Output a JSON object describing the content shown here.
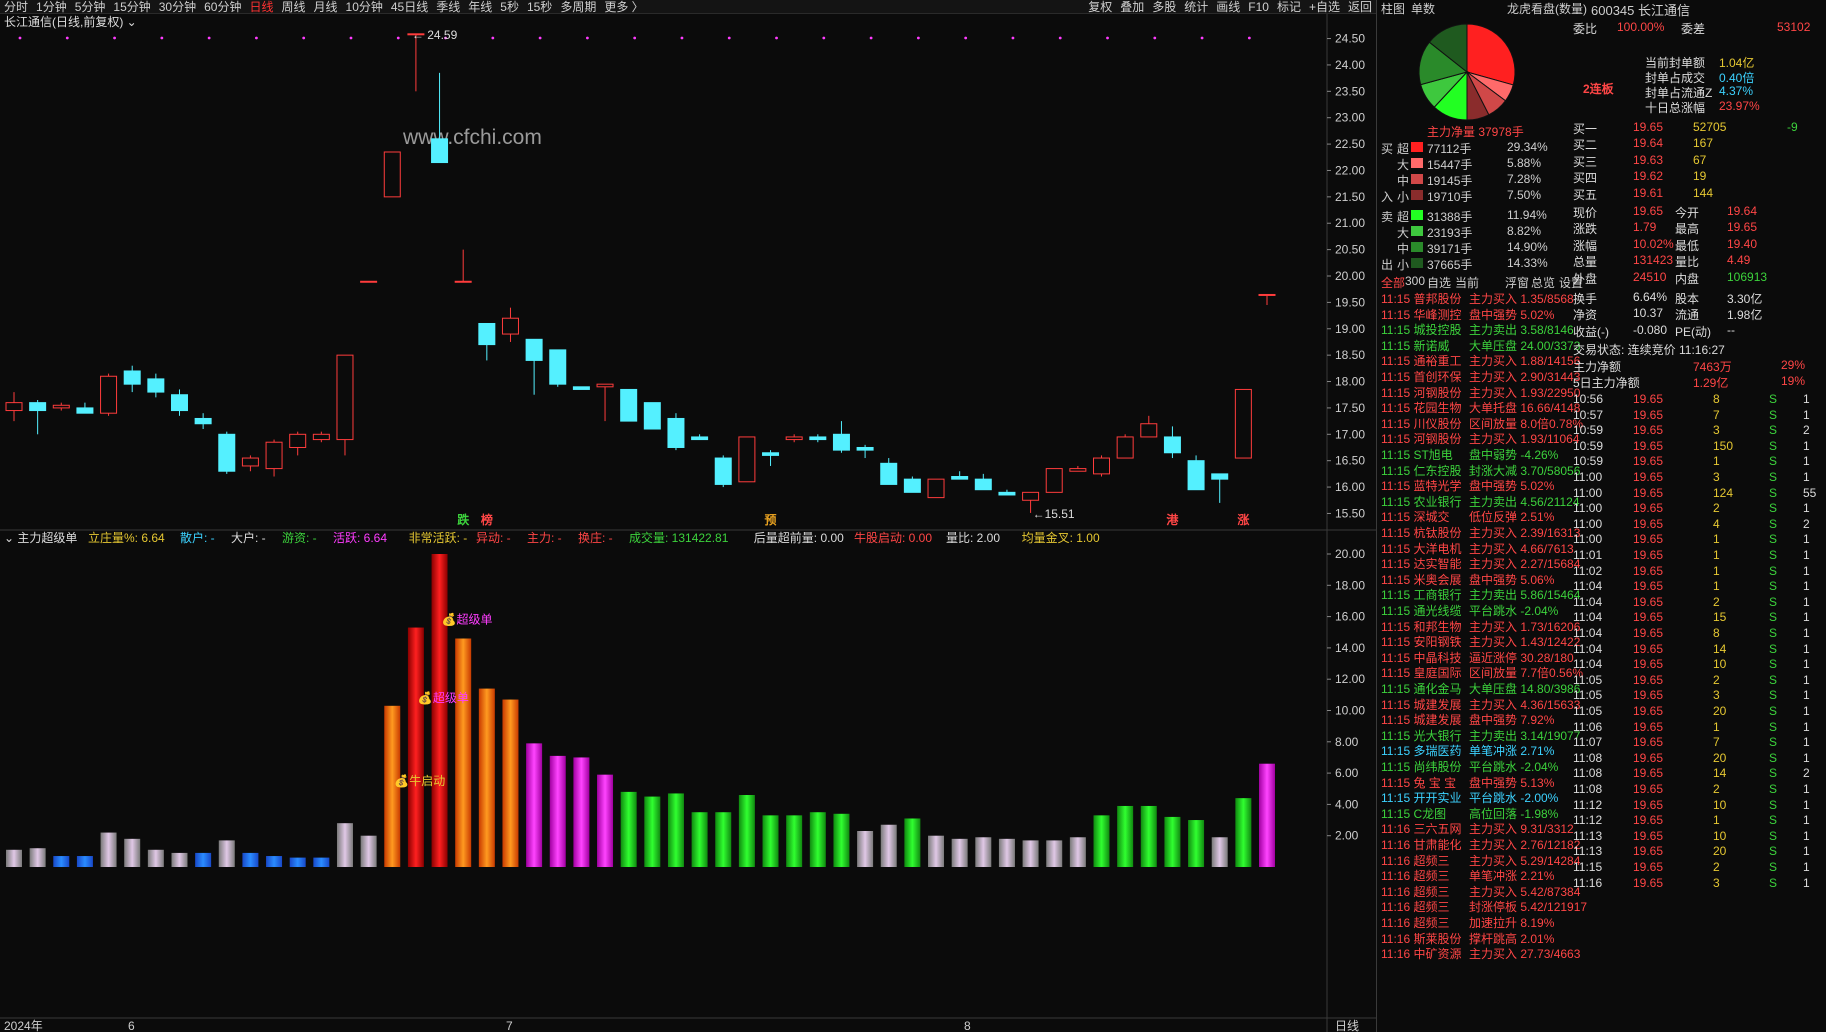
{
  "toolbar": {
    "periods": [
      "分时",
      "1分钟",
      "5分钟",
      "15分钟",
      "30分钟",
      "60分钟",
      "日线",
      "周线",
      "月线",
      "10分钟",
      "45日线",
      "季线",
      "年线",
      "5秒",
      "15秒",
      "多周期",
      "更多 〉"
    ],
    "active": "日线",
    "right": [
      "复权",
      "叠加",
      "多股",
      "统计",
      "画线",
      "F10",
      "标记",
      "+自选",
      "返回"
    ]
  },
  "main_chart": {
    "title": "长江通信(日线,前复权)",
    "watermark": "www.cfchi.com",
    "high_label": "24.59",
    "low_label": "15.51",
    "y_ticks": [
      "24.50",
      "24.00",
      "23.50",
      "23.00",
      "22.50",
      "22.00",
      "21.50",
      "21.00",
      "20.50",
      "20.00",
      "19.50",
      "19.00",
      "18.50",
      "18.00",
      "17.50",
      "17.00",
      "16.50",
      "16.00",
      "15.50"
    ],
    "markers": [
      "跌",
      "榜",
      "预",
      "港",
      "涨"
    ]
  },
  "indicator": {
    "name": "主力超级单",
    "fields": [
      [
        "立庄量%: 6.64",
        "y"
      ],
      [
        "散户: -",
        "c"
      ],
      [
        "大户: -",
        "w"
      ],
      [
        "游资: -",
        "g"
      ],
      [
        "活跃: 6.64",
        "m"
      ],
      [
        "非常活跃: -",
        "y"
      ],
      [
        "异动: -",
        "r"
      ],
      [
        "主力: -",
        "r"
      ],
      [
        "换庄: -",
        "r"
      ],
      [
        "成交量: 131422.81",
        "g"
      ],
      [
        "后量超前量: 0.00",
        "w"
      ],
      [
        "牛股启动: 0.00",
        "r"
      ],
      [
        "量比: 2.00",
        "w"
      ],
      [
        "均量金叉: 1.00",
        "y"
      ]
    ],
    "y_ticks": [
      "20.00",
      "18.00",
      "16.00",
      "14.00",
      "12.00",
      "10.00",
      "8.00",
      "6.00",
      "4.00",
      "2.00"
    ],
    "labels": [
      "超级单",
      "超级单",
      "牛启动"
    ]
  },
  "x_axis": {
    "labels": [
      "2024年",
      "6",
      "7",
      "8"
    ],
    "corner": "日线"
  },
  "chart_data": {
    "type": "candlestick",
    "candles": [
      [
        17.45,
        17.6,
        17.25,
        17.8
      ],
      [
        17.6,
        17.45,
        17.0,
        17.65
      ],
      [
        17.5,
        17.55,
        17.45,
        17.6
      ],
      [
        17.5,
        17.4,
        17.4,
        17.6
      ],
      [
        17.4,
        18.1,
        17.35,
        18.15
      ],
      [
        18.2,
        17.95,
        17.8,
        18.3
      ],
      [
        18.05,
        17.8,
        17.7,
        18.15
      ],
      [
        17.75,
        17.45,
        17.35,
        17.85
      ],
      [
        17.3,
        17.2,
        17.1,
        17.4
      ],
      [
        17.0,
        16.3,
        16.25,
        17.05
      ],
      [
        16.4,
        16.55,
        16.3,
        16.6
      ],
      [
        16.35,
        16.85,
        16.2,
        16.9
      ],
      [
        16.75,
        17.0,
        16.6,
        17.05
      ],
      [
        16.9,
        17.0,
        16.85,
        17.05
      ],
      [
        16.9,
        18.5,
        16.6,
        18.5
      ],
      [
        19.9,
        19.9,
        19.9,
        19.9
      ],
      [
        21.5,
        22.35,
        21.5,
        22.35
      ],
      [
        24.59,
        24.59,
        23.5,
        24.59
      ],
      [
        22.6,
        22.15,
        22.15,
        23.85
      ],
      [
        19.9,
        19.9,
        19.9,
        20.5
      ],
      [
        19.1,
        18.7,
        18.4,
        19.1
      ],
      [
        18.9,
        19.2,
        18.75,
        19.4
      ],
      [
        18.8,
        18.4,
        17.75,
        18.8
      ],
      [
        18.6,
        17.95,
        17.9,
        18.6
      ],
      [
        17.9,
        17.85,
        17.85,
        17.9
      ],
      [
        17.9,
        17.95,
        17.25,
        17.95
      ],
      [
        17.85,
        17.25,
        17.25,
        17.85
      ],
      [
        17.6,
        17.1,
        17.1,
        17.6
      ],
      [
        17.3,
        16.75,
        16.7,
        17.4
      ],
      [
        16.95,
        16.9,
        16.9,
        17.0
      ],
      [
        16.55,
        16.05,
        16.0,
        16.6
      ],
      [
        16.1,
        16.95,
        16.1,
        16.95
      ],
      [
        16.65,
        16.6,
        16.4,
        16.7
      ],
      [
        16.9,
        16.95,
        16.85,
        17.0
      ],
      [
        16.95,
        16.9,
        16.85,
        17.0
      ],
      [
        17.0,
        16.7,
        16.65,
        17.25
      ],
      [
        16.75,
        16.7,
        16.55,
        16.8
      ],
      [
        16.45,
        16.05,
        16.05,
        16.55
      ],
      [
        16.15,
        15.9,
        15.9,
        16.2
      ],
      [
        15.8,
        16.15,
        15.8,
        16.15
      ],
      [
        16.2,
        16.15,
        16.15,
        16.3
      ],
      [
        16.15,
        15.95,
        15.95,
        16.25
      ],
      [
        15.9,
        15.85,
        15.85,
        15.95
      ],
      [
        15.75,
        15.9,
        15.51,
        15.9
      ],
      [
        15.9,
        16.35,
        15.9,
        16.35
      ],
      [
        16.3,
        16.35,
        16.3,
        16.4
      ],
      [
        16.25,
        16.55,
        16.2,
        16.6
      ],
      [
        16.55,
        16.95,
        16.55,
        17.0
      ],
      [
        16.95,
        17.2,
        16.95,
        17.35
      ],
      [
        16.95,
        16.65,
        16.55,
        17.15
      ],
      [
        16.5,
        15.95,
        15.95,
        16.6
      ],
      [
        16.25,
        16.15,
        15.7,
        16.25
      ],
      [
        16.55,
        17.85,
        16.55,
        17.85
      ],
      [
        19.65,
        19.65,
        19.45,
        19.65
      ]
    ],
    "vol": [
      [
        1.1,
        "s"
      ],
      [
        1.2,
        "s"
      ],
      [
        0.7,
        "b"
      ],
      [
        0.7,
        "b"
      ],
      [
        2.2,
        "s"
      ],
      [
        1.8,
        "s"
      ],
      [
        1.1,
        "s"
      ],
      [
        0.9,
        "s"
      ],
      [
        0.9,
        "b"
      ],
      [
        1.7,
        "s"
      ],
      [
        0.9,
        "b"
      ],
      [
        0.7,
        "b"
      ],
      [
        0.6,
        "b"
      ],
      [
        0.6,
        "b"
      ],
      [
        2.8,
        "s"
      ],
      [
        2.0,
        "s"
      ],
      [
        10.3,
        "o"
      ],
      [
        15.3,
        "d"
      ],
      [
        20.0,
        "d"
      ],
      [
        14.6,
        "o"
      ],
      [
        11.4,
        "o"
      ],
      [
        10.7,
        "o"
      ],
      [
        7.9,
        "p"
      ],
      [
        7.1,
        "p"
      ],
      [
        7.0,
        "p"
      ],
      [
        5.9,
        "p"
      ],
      [
        4.8,
        "gr"
      ],
      [
        4.5,
        "gr"
      ],
      [
        4.7,
        "gr"
      ],
      [
        3.5,
        "gr"
      ],
      [
        3.5,
        "gr"
      ],
      [
        4.6,
        "gr"
      ],
      [
        3.3,
        "gr"
      ],
      [
        3.3,
        "gr"
      ],
      [
        3.5,
        "gr"
      ],
      [
        3.4,
        "gr"
      ],
      [
        2.3,
        "s"
      ],
      [
        2.7,
        "s"
      ],
      [
        3.1,
        "gr"
      ],
      [
        2.0,
        "s"
      ],
      [
        1.8,
        "s"
      ],
      [
        1.9,
        "s"
      ],
      [
        1.8,
        "s"
      ],
      [
        1.7,
        "s"
      ],
      [
        1.7,
        "s"
      ],
      [
        1.9,
        "s"
      ],
      [
        3.3,
        "gr"
      ],
      [
        3.9,
        "gr"
      ],
      [
        3.9,
        "gr"
      ],
      [
        3.2,
        "gr"
      ],
      [
        3.0,
        "gr"
      ],
      [
        1.9,
        "s"
      ],
      [
        4.4,
        "gr"
      ],
      [
        6.6,
        "p"
      ]
    ]
  },
  "right": {
    "head": {
      "tabs": [
        "柱图",
        "单数"
      ],
      "title": "龙虎看盘(数量)",
      "code": "600345 长江通信"
    },
    "pie": {
      "label": "主力净量 37978手",
      "slices": [
        [
          29.34,
          "#ff2020"
        ],
        [
          5.88,
          "#ff6a6a"
        ],
        [
          7.28,
          "#d04848"
        ],
        [
          7.5,
          "#8a2c2c"
        ],
        [
          11.94,
          "#22ff22"
        ],
        [
          8.82,
          "#3ec83e"
        ],
        [
          14.9,
          "#2a8a2a"
        ],
        [
          14.33,
          "#1f5a1f"
        ]
      ]
    },
    "flow": [
      [
        "买",
        "超",
        "77112手",
        "29.34%",
        "#ff2020"
      ],
      [
        "",
        "大",
        "15447手",
        "5.88%",
        "#ff6a6a"
      ],
      [
        "",
        "中",
        "19145手",
        "7.28%",
        "#d04848"
      ],
      [
        "入",
        "小",
        "19710手",
        "7.50%",
        "#8a2c2c"
      ],
      [
        "卖",
        "超",
        "31388手",
        "11.94%",
        "#22ff22"
      ],
      [
        "",
        "大",
        "23193手",
        "8.82%",
        "#3ec83e"
      ],
      [
        "",
        "中",
        "39171手",
        "14.90%",
        "#2a8a2a"
      ],
      [
        "出",
        "小",
        "37665手",
        "14.33%",
        "#1f5a1f"
      ]
    ],
    "filters": [
      "全部",
      "300",
      "自选",
      "当前",
      "浮窗",
      "总览",
      "设置"
    ],
    "alerts": [
      [
        "11:15",
        "普邦股份",
        "主力买入",
        "1.35/8568",
        "r"
      ],
      [
        "11:15",
        "华峰测控",
        "盘中强势",
        "5.02%",
        "r"
      ],
      [
        "11:15",
        "城投控股",
        "主力卖出",
        "3.58/8146",
        "g"
      ],
      [
        "11:15",
        "新诺威",
        "大单压盘",
        "24.00/3373",
        "g"
      ],
      [
        "11:15",
        "通裕重工",
        "主力买入",
        "1.88/14156",
        "r"
      ],
      [
        "11:15",
        "首创环保",
        "主力买入",
        "2.90/31443",
        "r"
      ],
      [
        "11:15",
        "河钢股份",
        "主力买入",
        "1.93/22950",
        "r"
      ],
      [
        "11:15",
        "花园生物",
        "大单托盘",
        "16.66/4148",
        "r"
      ],
      [
        "11:15",
        "川仪股份",
        "区间放量",
        "8.0倍0.78%",
        "r"
      ],
      [
        "11:15",
        "河钢股份",
        "主力买入",
        "1.93/11064",
        "r"
      ],
      [
        "11:15",
        "ST旭电",
        "盘中弱势",
        "-4.26%",
        "g"
      ],
      [
        "11:15",
        "仁东控股",
        "封涨大减",
        "3.70/58056",
        "g"
      ],
      [
        "11:15",
        "蓝特光学",
        "盘中强势",
        "5.02%",
        "r"
      ],
      [
        "11:15",
        "农业银行",
        "主力卖出",
        "4.56/21124",
        "g"
      ],
      [
        "11:15",
        "深城交",
        "低位反弹",
        "2.51%",
        "r"
      ],
      [
        "11:15",
        "杭钛股份",
        "主力买入",
        "2.39/16313",
        "r"
      ],
      [
        "11:15",
        "大洋电机",
        "主力买入",
        "4.66/7613",
        "r"
      ],
      [
        "11:15",
        "达实智能",
        "主力买入",
        "2.27/15684",
        "r"
      ],
      [
        "11:15",
        "米奥会展",
        "盘中强势",
        "5.06%",
        "r"
      ],
      [
        "11:15",
        "工商银行",
        "主力卖出",
        "5.86/15464",
        "g"
      ],
      [
        "11:15",
        "通光线缆",
        "平台跳水",
        "-2.04%",
        "g"
      ],
      [
        "11:15",
        "和邦生物",
        "主力买入",
        "1.73/16206",
        "r"
      ],
      [
        "11:15",
        "安阳钢铁",
        "主力买入",
        "1.43/12422",
        "r"
      ],
      [
        "11:15",
        "中晶科技",
        "逼近涨停",
        "30.28/180",
        "r"
      ],
      [
        "11:15",
        "皇庭国际",
        "区间放量",
        "7.7倍0.56%",
        "r"
      ],
      [
        "11:15",
        "通化金马",
        "大单压盘",
        "14.80/3986",
        "g"
      ],
      [
        "11:15",
        "城建发展",
        "主力买入",
        "4.36/15633",
        "r"
      ],
      [
        "11:15",
        "城建发展",
        "盘中强势",
        "7.92%",
        "r"
      ],
      [
        "11:15",
        "光大银行",
        "主力卖出",
        "3.14/19077",
        "g"
      ],
      [
        "11:15",
        "多瑞医药",
        "单笔冲涨",
        "2.71%",
        "c"
      ],
      [
        "11:15",
        "尚纬股份",
        "平台跳水",
        "-2.04%",
        "g"
      ],
      [
        "11:15",
        "兔 宝 宝",
        "盘中强势",
        "5.13%",
        "r"
      ],
      [
        "11:15",
        "开开实业",
        "平台跳水",
        "-2.00%",
        "c"
      ],
      [
        "11:15",
        "C龙图",
        "高位回落",
        "-1.98%",
        "g"
      ],
      [
        "11:16",
        "三六五网",
        "主力买入",
        "9.31/3312",
        "r"
      ],
      [
        "11:16",
        "甘肃能化",
        "主力买入",
        "2.76/12182",
        "r"
      ],
      [
        "11:16",
        "超频三",
        "主力买入",
        "5.29/14284",
        "r"
      ],
      [
        "11:16",
        "超频三",
        "单笔冲涨",
        "2.21%",
        "r"
      ],
      [
        "11:16",
        "超频三",
        "主力买入",
        "5.42/87384",
        "r"
      ],
      [
        "11:16",
        "超频三",
        "封涨停板",
        "5.42/121917",
        "r"
      ],
      [
        "11:16",
        "超频三",
        "加速拉升",
        "8.19%",
        "r"
      ],
      [
        "11:16",
        "斯莱股份",
        "撑杆跳高",
        "2.01%",
        "r"
      ],
      [
        "11:16",
        "中矿资源",
        "主力买入",
        "27.73/4663",
        "r"
      ]
    ],
    "q": {
      "ratio": [
        "委比",
        "100.00%",
        "委差",
        "53102"
      ],
      "seal": [
        [
          "当前封单额",
          "1.04亿",
          "y"
        ],
        [
          "封单占成交",
          "0.40倍",
          "c"
        ],
        [
          "封单占流通Z",
          "4.37%",
          "c"
        ],
        [
          "十日总涨幅",
          "23.97%",
          "r"
        ]
      ],
      "streak": "2连板",
      "bids": [
        [
          "买一",
          "19.65",
          "52705",
          "-9"
        ],
        [
          "买二",
          "19.64",
          "167",
          ""
        ],
        [
          "买三",
          "19.63",
          "67",
          ""
        ],
        [
          "买四",
          "19.62",
          "19",
          ""
        ],
        [
          "买五",
          "19.61",
          "144",
          ""
        ]
      ],
      "stats": [
        [
          "现价",
          "19.65",
          "今开",
          "19.64"
        ],
        [
          "涨跌",
          "1.79",
          "最高",
          "19.65"
        ],
        [
          "涨幅",
          "10.02%",
          "最低",
          "19.40"
        ],
        [
          "总量",
          "131423",
          "量比",
          "4.49"
        ],
        [
          "外盘",
          "24510",
          "内盘",
          "106913"
        ],
        [
          "换手",
          "6.64%",
          "股本",
          "3.30亿"
        ],
        [
          "净资",
          "10.37",
          "流通",
          "1.98亿"
        ],
        [
          "收益(-)",
          "-0.080",
          "PE(动)",
          "--"
        ]
      ],
      "state": "交易状态: 连续竞价 11:16:27",
      "net": [
        [
          "主力净额",
          "7463万",
          "29%"
        ],
        [
          "5日主力净额",
          "1.29亿",
          "19%"
        ]
      ],
      "ticks": [
        [
          "10:56",
          "19.65",
          "8",
          "S",
          "1"
        ],
        [
          "10:57",
          "19.65",
          "7",
          "S",
          "1"
        ],
        [
          "10:59",
          "19.65",
          "3",
          "S",
          "2"
        ],
        [
          "10:59",
          "19.65",
          "150",
          "S",
          "1"
        ],
        [
          "10:59",
          "19.65",
          "1",
          "S",
          "1"
        ],
        [
          "11:00",
          "19.65",
          "3",
          "S",
          "1"
        ],
        [
          "11:00",
          "19.65",
          "124",
          "S",
          "55"
        ],
        [
          "11:00",
          "19.65",
          "2",
          "S",
          "1"
        ],
        [
          "11:00",
          "19.65",
          "4",
          "S",
          "2"
        ],
        [
          "11:00",
          "19.65",
          "1",
          "S",
          "1"
        ],
        [
          "11:01",
          "19.65",
          "1",
          "S",
          "1"
        ],
        [
          "11:02",
          "19.65",
          "1",
          "S",
          "1"
        ],
        [
          "11:04",
          "19.65",
          "1",
          "S",
          "1"
        ],
        [
          "11:04",
          "19.65",
          "2",
          "S",
          "1"
        ],
        [
          "11:04",
          "19.65",
          "15",
          "S",
          "1"
        ],
        [
          "11:04",
          "19.65",
          "8",
          "S",
          "1"
        ],
        [
          "11:04",
          "19.65",
          "14",
          "S",
          "1"
        ],
        [
          "11:04",
          "19.65",
          "10",
          "S",
          "1"
        ],
        [
          "11:05",
          "19.65",
          "2",
          "S",
          "1"
        ],
        [
          "11:05",
          "19.65",
          "3",
          "S",
          "1"
        ],
        [
          "11:05",
          "19.65",
          "20",
          "S",
          "1"
        ],
        [
          "11:06",
          "19.65",
          "1",
          "S",
          "1"
        ],
        [
          "11:07",
          "19.65",
          "7",
          "S",
          "1"
        ],
        [
          "11:08",
          "19.65",
          "20",
          "S",
          "1"
        ],
        [
          "11:08",
          "19.65",
          "14",
          "S",
          "2"
        ],
        [
          "11:08",
          "19.65",
          "2",
          "S",
          "1"
        ],
        [
          "11:12",
          "19.65",
          "10",
          "S",
          "1"
        ],
        [
          "11:12",
          "19.65",
          "1",
          "S",
          "1"
        ],
        [
          "11:13",
          "19.65",
          "10",
          "S",
          "1"
        ],
        [
          "11:13",
          "19.65",
          "20",
          "S",
          "1"
        ],
        [
          "11:15",
          "19.65",
          "2",
          "S",
          "1"
        ],
        [
          "11:16",
          "19.65",
          "3",
          "S",
          "1"
        ]
      ]
    }
  }
}
